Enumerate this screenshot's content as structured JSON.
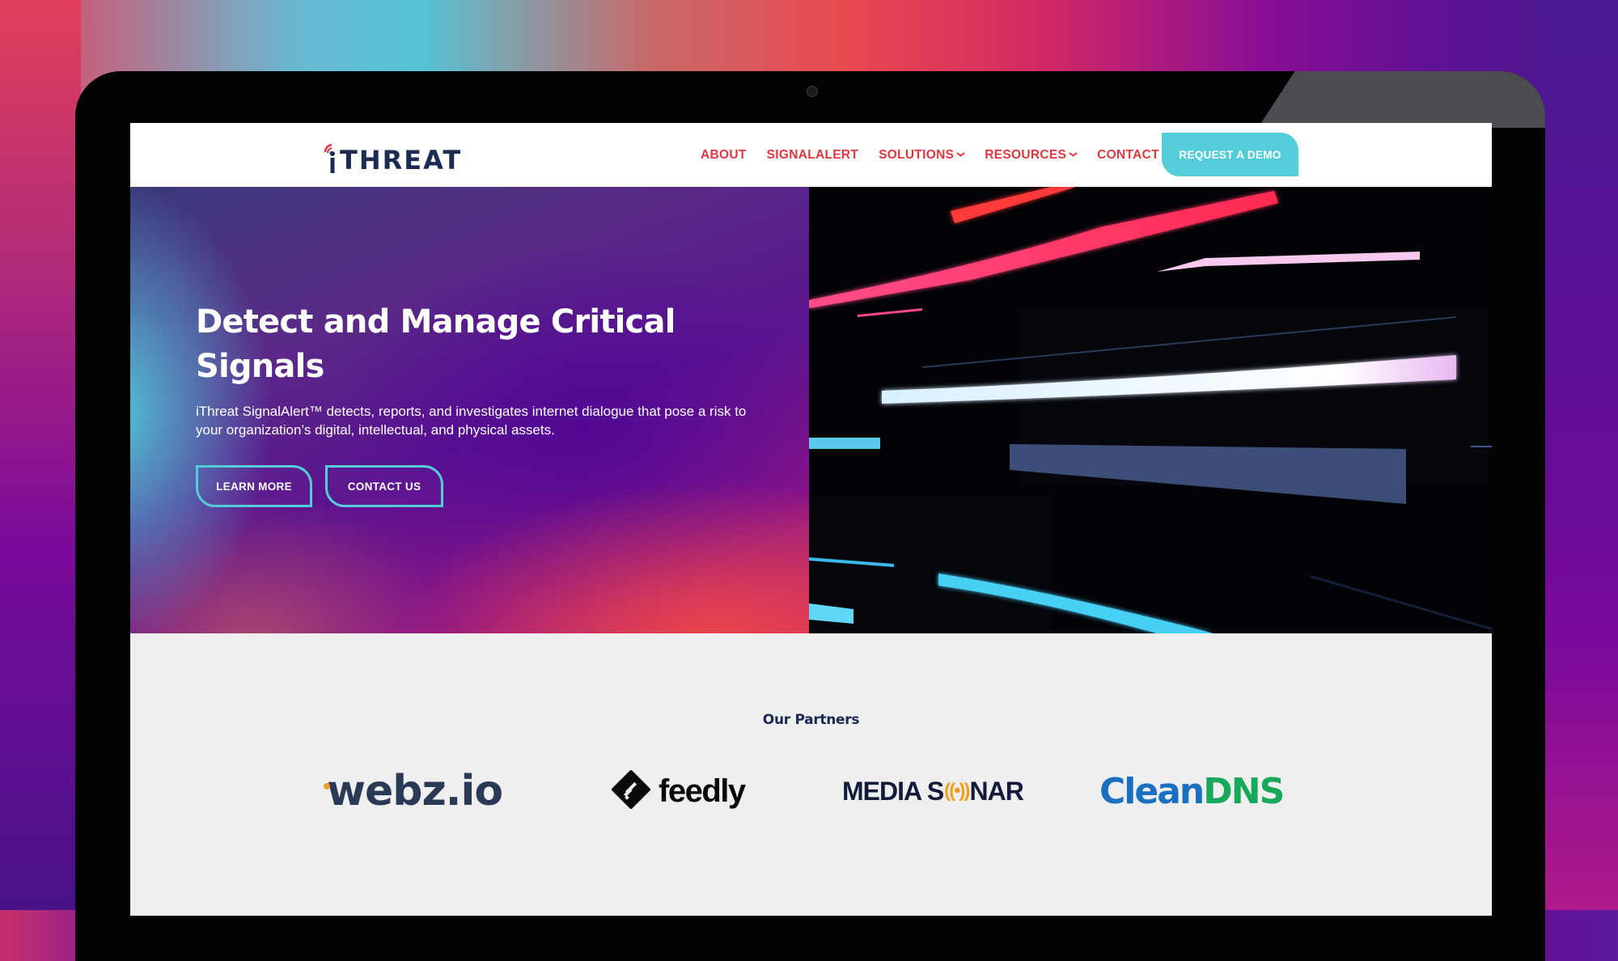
{
  "nav": {
    "logo_text": "THREAT",
    "logo_prefix": "i",
    "items": [
      {
        "label": "ABOUT",
        "has_dropdown": false
      },
      {
        "label": "SIGNALALERT",
        "has_dropdown": false
      },
      {
        "label": "SOLUTIONS",
        "has_dropdown": true
      },
      {
        "label": "RESOURCES",
        "has_dropdown": true
      },
      {
        "label": "CONTACT",
        "has_dropdown": false
      }
    ],
    "chevron": "⌄",
    "cta_label": "REQUEST A DEMO"
  },
  "hero": {
    "title": "Detect and Manage Critical Signals",
    "description": "iThreat SignalAlert™ detects, reports, and investigates internet dialogue that pose a risk to your organization’s digital, intellectual, and physical assets.",
    "buttons": [
      {
        "label": "LEARN MORE"
      },
      {
        "label": "CONTACT US"
      }
    ]
  },
  "partners": {
    "title": "Our Partners",
    "logos": [
      {
        "name": "webz.io",
        "text": "webz.io"
      },
      {
        "name": "feedly",
        "text": "feedly"
      },
      {
        "name": "Media Sonar",
        "text_left": "MEDIA S",
        "wave": "((•))",
        "text_right": "NAR"
      },
      {
        "name": "CleanDNS",
        "text_left": "Clean",
        "text_right": "DNS"
      }
    ]
  },
  "colors": {
    "nav_link": "#e0373f",
    "accent_cyan": "#55cdd8",
    "logo_navy": "#1c2b52",
    "partners_bg": "#efefef"
  }
}
